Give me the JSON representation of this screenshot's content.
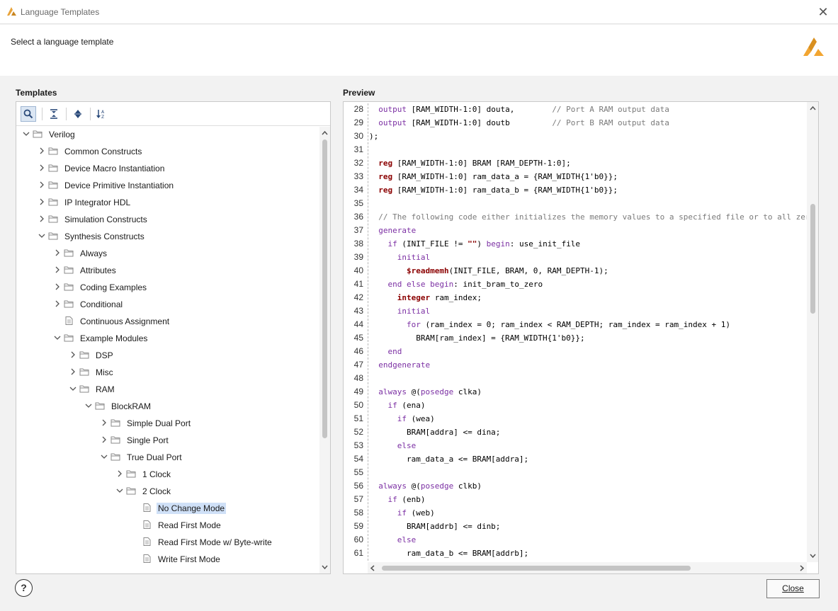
{
  "window": {
    "title": "Language Templates",
    "close_icon": "close-icon"
  },
  "header": {
    "subtitle": "Select a language template"
  },
  "templates": {
    "label": "Templates",
    "toolbar": [
      {
        "icon": "search-icon",
        "active": true
      },
      {
        "icon": "collapse-all-icon"
      },
      {
        "icon": "expand-all-icon"
      },
      {
        "icon": "sort-az-icon"
      }
    ],
    "tree": [
      {
        "label": "Verilog",
        "depth": 0,
        "expander": "open",
        "icon": "folder"
      },
      {
        "label": "Common Constructs",
        "depth": 1,
        "expander": "closed",
        "icon": "folder"
      },
      {
        "label": "Device Macro Instantiation",
        "depth": 1,
        "expander": "closed",
        "icon": "folder"
      },
      {
        "label": "Device Primitive Instantiation",
        "depth": 1,
        "expander": "closed",
        "icon": "folder"
      },
      {
        "label": "IP Integrator HDL",
        "depth": 1,
        "expander": "closed",
        "icon": "folder"
      },
      {
        "label": "Simulation Constructs",
        "depth": 1,
        "expander": "closed",
        "icon": "folder"
      },
      {
        "label": "Synthesis Constructs",
        "depth": 1,
        "expander": "open",
        "icon": "folder"
      },
      {
        "label": "Always",
        "depth": 2,
        "expander": "closed",
        "icon": "folder"
      },
      {
        "label": "Attributes",
        "depth": 2,
        "expander": "closed",
        "icon": "folder"
      },
      {
        "label": "Coding Examples",
        "depth": 2,
        "expander": "closed",
        "icon": "folder"
      },
      {
        "label": "Conditional",
        "depth": 2,
        "expander": "closed",
        "icon": "folder"
      },
      {
        "label": "Continuous Assignment",
        "depth": 2,
        "expander": "none",
        "icon": "file"
      },
      {
        "label": "Example Modules",
        "depth": 2,
        "expander": "open",
        "icon": "folder"
      },
      {
        "label": "DSP",
        "depth": 3,
        "expander": "closed",
        "icon": "folder"
      },
      {
        "label": "Misc",
        "depth": 3,
        "expander": "closed",
        "icon": "folder"
      },
      {
        "label": "RAM",
        "depth": 3,
        "expander": "open",
        "icon": "folder"
      },
      {
        "label": "BlockRAM",
        "depth": 4,
        "expander": "open",
        "icon": "folder"
      },
      {
        "label": "Simple Dual Port",
        "depth": 5,
        "expander": "closed",
        "icon": "folder"
      },
      {
        "label": "Single Port",
        "depth": 5,
        "expander": "closed",
        "icon": "folder"
      },
      {
        "label": "True Dual Port",
        "depth": 5,
        "expander": "open",
        "icon": "folder"
      },
      {
        "label": "1 Clock",
        "depth": 6,
        "expander": "closed",
        "icon": "folder"
      },
      {
        "label": "2 Clock",
        "depth": 6,
        "expander": "open",
        "icon": "folder"
      },
      {
        "label": "No Change Mode",
        "depth": 7,
        "expander": "none",
        "icon": "file",
        "selected": true
      },
      {
        "label": "Read First Mode",
        "depth": 7,
        "expander": "none",
        "icon": "file"
      },
      {
        "label": "Read First Mode w/ Byte-write",
        "depth": 7,
        "expander": "none",
        "icon": "file"
      },
      {
        "label": "Write First Mode",
        "depth": 7,
        "expander": "none",
        "icon": "file"
      }
    ],
    "scroll_fraction": 0.0
  },
  "preview": {
    "label": "Preview",
    "lines": [
      {
        "n": "28",
        "t": "  <span class='kw'>output</span> [RAM_WIDTH-1:0] douta,        <span class='cm'>// Port A RAM output data</span>"
      },
      {
        "n": "29",
        "t": "  <span class='kw'>output</span> [RAM_WIDTH-1:0] doutb         <span class='cm'>// Port B RAM output data</span>"
      },
      {
        "n": "30",
        "t": ");"
      },
      {
        "n": "31",
        "t": ""
      },
      {
        "n": "32",
        "t": "  <span class='kb'>reg</span> [RAM_WIDTH-1:0] BRAM [RAM_DEPTH-1:0];"
      },
      {
        "n": "33",
        "t": "  <span class='kb'>reg</span> [RAM_WIDTH-1:0] ram_data_a = {RAM_WIDTH{1'b0}};"
      },
      {
        "n": "34",
        "t": "  <span class='kb'>reg</span> [RAM_WIDTH-1:0] ram_data_b = {RAM_WIDTH{1'b0}};"
      },
      {
        "n": "35",
        "t": ""
      },
      {
        "n": "36",
        "t": "  <span class='cm'>// The following code either initializes the memory values to a specified file or to all zeros to mat</span>"
      },
      {
        "n": "37",
        "t": "  <span class='kw'>generate</span>"
      },
      {
        "n": "38",
        "t": "    <span class='kw'>if</span> (INIT_FILE != <span class='kb'>\"\"</span>) <span class='kw'>begin</span>: use_init_file"
      },
      {
        "n": "39",
        "t": "      <span class='kw'>initial</span>"
      },
      {
        "n": "40",
        "t": "        <span class='kb'>$readmemh</span>(INIT_FILE, BRAM, 0, RAM_DEPTH-1);"
      },
      {
        "n": "41",
        "t": "    <span class='kw'>end</span> <span class='kw'>else</span> <span class='kw'>begin</span>: init_bram_to_zero"
      },
      {
        "n": "42",
        "t": "      <span class='kb'>integer</span> ram_index;"
      },
      {
        "n": "43",
        "t": "      <span class='kw'>initial</span>"
      },
      {
        "n": "44",
        "t": "        <span class='kw'>for</span> (ram_index = 0; ram_index &lt; RAM_DEPTH; ram_index = ram_index + 1)"
      },
      {
        "n": "45",
        "t": "          BRAM[ram_index] = {RAM_WIDTH{1'b0}};"
      },
      {
        "n": "46",
        "t": "    <span class='kw'>end</span>"
      },
      {
        "n": "47",
        "t": "  <span class='kw'>endgenerate</span>"
      },
      {
        "n": "48",
        "t": ""
      },
      {
        "n": "49",
        "t": "  <span class='kw'>always</span> @(<span class='kw'>posedge</span> clka)"
      },
      {
        "n": "50",
        "t": "    <span class='kw'>if</span> (ena)"
      },
      {
        "n": "51",
        "t": "      <span class='kw'>if</span> (wea)"
      },
      {
        "n": "52",
        "t": "        BRAM[addra] &lt;= dina;"
      },
      {
        "n": "53",
        "t": "      <span class='kw'>else</span>"
      },
      {
        "n": "54",
        "t": "        ram_data_a &lt;= BRAM[addra];"
      },
      {
        "n": "55",
        "t": ""
      },
      {
        "n": "56",
        "t": "  <span class='kw'>always</span> @(<span class='kw'>posedge</span> clkb)"
      },
      {
        "n": "57",
        "t": "    <span class='kw'>if</span> (enb)"
      },
      {
        "n": "58",
        "t": "      <span class='kw'>if</span> (web)"
      },
      {
        "n": "59",
        "t": "        BRAM[addrb] &lt;= dinb;"
      },
      {
        "n": "60",
        "t": "      <span class='kw'>else</span>"
      },
      {
        "n": "61",
        "t": "        ram_data_b &lt;= BRAM[addrb];"
      }
    ]
  },
  "footer": {
    "help_label": "?",
    "close_label": "Close"
  },
  "colors": {
    "selection": "#cfe0f7",
    "keyword": "#7b2fa3",
    "keyword_bold": "#8b0000",
    "comment": "#7a7a7a"
  }
}
